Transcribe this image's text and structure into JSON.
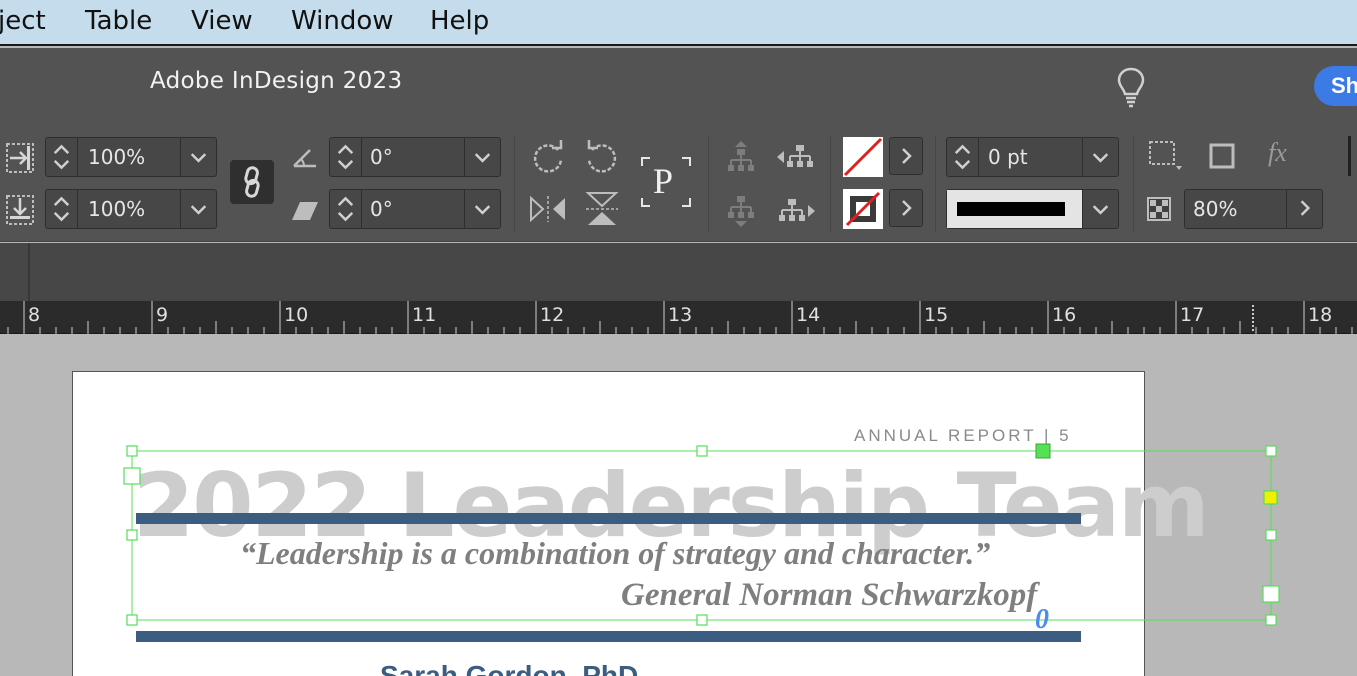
{
  "menubar": {
    "items": [
      "ject",
      "Table",
      "View",
      "Window",
      "Help"
    ]
  },
  "app": {
    "title": "Adobe InDesign 2023",
    "share_label": "Sh"
  },
  "control_panel": {
    "scale_x": "100%",
    "scale_y": "100%",
    "rotation_angle": "0°",
    "shear_angle": "0°",
    "stroke_weight": "0 pt",
    "opacity": "80%",
    "text_frame_glyph": "P",
    "fx_label": "fx"
  },
  "ruler": {
    "labels": [
      "8",
      "9",
      "10",
      "11",
      "12",
      "13",
      "14",
      "15",
      "16",
      "17",
      "18"
    ]
  },
  "document": {
    "header": "ANNUAL REPORT | 5",
    "title": "2022 Leadership Team",
    "quote": "“Leadership is a combination of strategy and character.”",
    "attribution": "General Norman Schwarzkopf",
    "cut_name": "Sarah Gordon, PhD",
    "accent_color": "#3c5d82",
    "selection_color": "#55e055"
  }
}
